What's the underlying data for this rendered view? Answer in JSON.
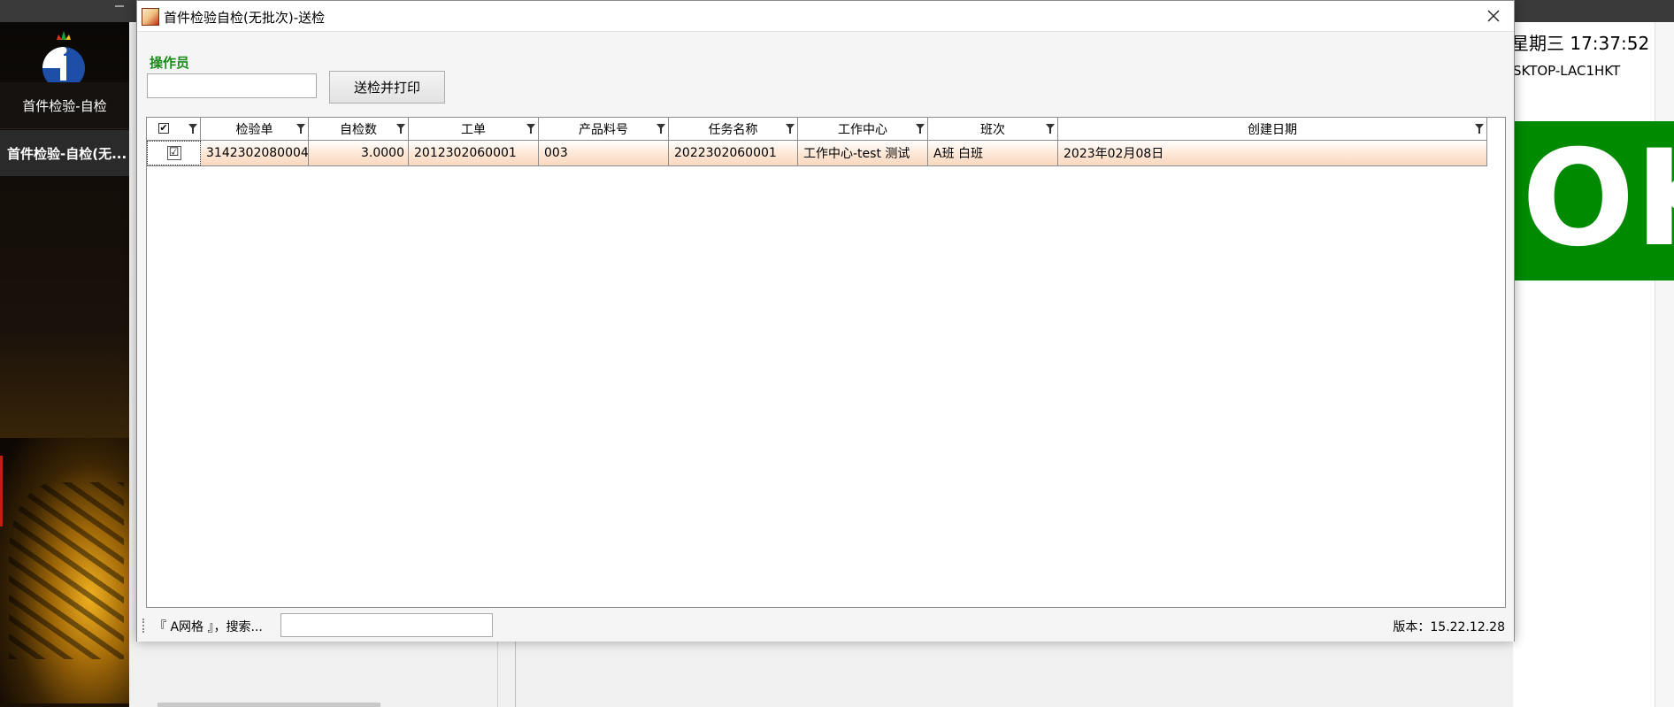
{
  "background_app": {
    "nav_items": [
      "首件检验-自检",
      "首件检验-自检(无..."
    ],
    "datetime": "星期三 17:37:52",
    "machine_name": "SKTOP-LAC1HKT",
    "status_big": "OK",
    "status_color": "#008a00"
  },
  "dialog": {
    "title": "首件检验自检(无批次)-送检",
    "close_icon": "close-icon",
    "operator_label": "操作员",
    "operator_value": "",
    "send_button": "送检并打印"
  },
  "grid": {
    "columns": [
      "",
      "检验单",
      "自检数",
      "工单",
      "产品料号",
      "任务名称",
      "工作中心",
      "班次",
      "创建日期"
    ],
    "rows": [
      {
        "checked": "☑",
        "inspection_no": "3142302080004",
        "self_check_qty": "3.0000",
        "work_order": "2012302060001",
        "product_code": "003",
        "task_name": "2022302060001",
        "work_center": "工作中心-test 测试",
        "shift": "A班 白班",
        "created_date": "2023年02月08日"
      }
    ]
  },
  "statusbar": {
    "grid_name": "『 A网格 』，搜索...",
    "search_value": "",
    "version": "版本：15.22.12.28"
  },
  "colors": {
    "operator_label": "#1b8a1b",
    "row_highlight": "#fbd8c0"
  }
}
